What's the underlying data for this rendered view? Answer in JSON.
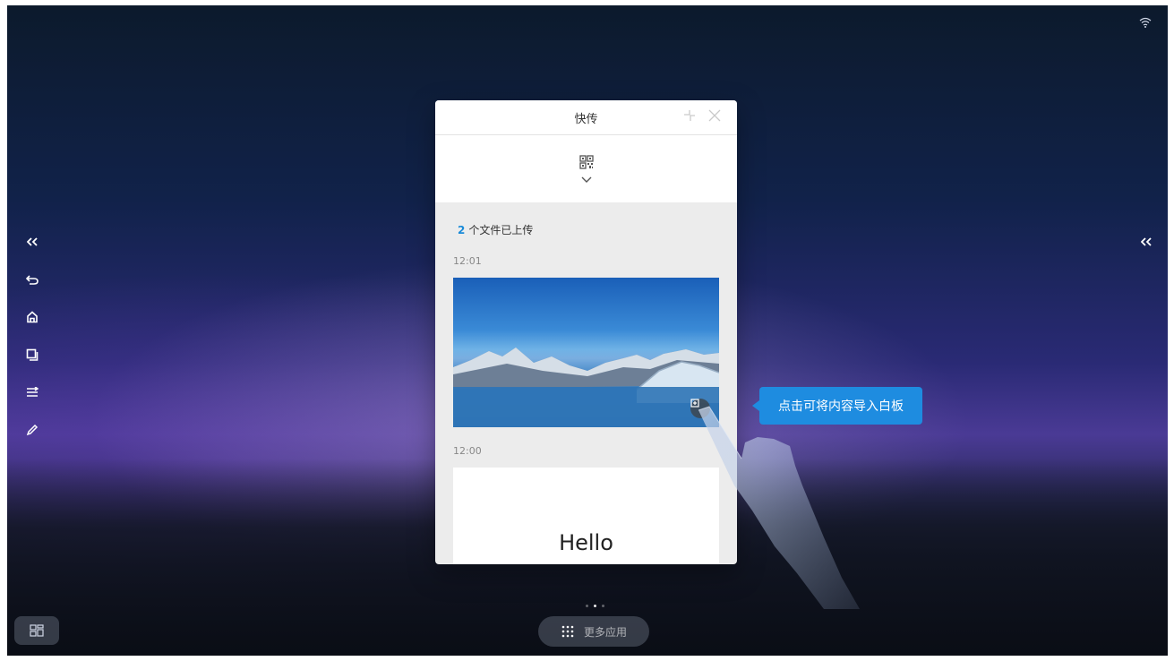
{
  "panel": {
    "title": "快传",
    "upload_count": "2",
    "upload_suffix": "个文件已上传",
    "items": [
      {
        "time": "12:01",
        "type": "image"
      },
      {
        "time": "12:00",
        "type": "text",
        "content": "Hello"
      }
    ]
  },
  "tooltip": {
    "text": "点击可将内容导入白板"
  },
  "dock": {
    "more_apps_label": "更多应用",
    "page_index": 1,
    "page_count": 3
  },
  "icons": {
    "left_rail": [
      "double-chevron-left-icon",
      "back-icon",
      "home-icon",
      "window-switch-icon",
      "menu-icon",
      "pen-icon"
    ],
    "right_rail": [
      "double-chevron-left-icon"
    ],
    "status": [
      "wifi-icon"
    ],
    "panel_header": [
      "minimize-icon",
      "close-icon"
    ]
  },
  "colors": {
    "accent_blue": "#1e8ce0",
    "count_blue": "#1a8bd8",
    "panel_bg": "#ececec"
  }
}
